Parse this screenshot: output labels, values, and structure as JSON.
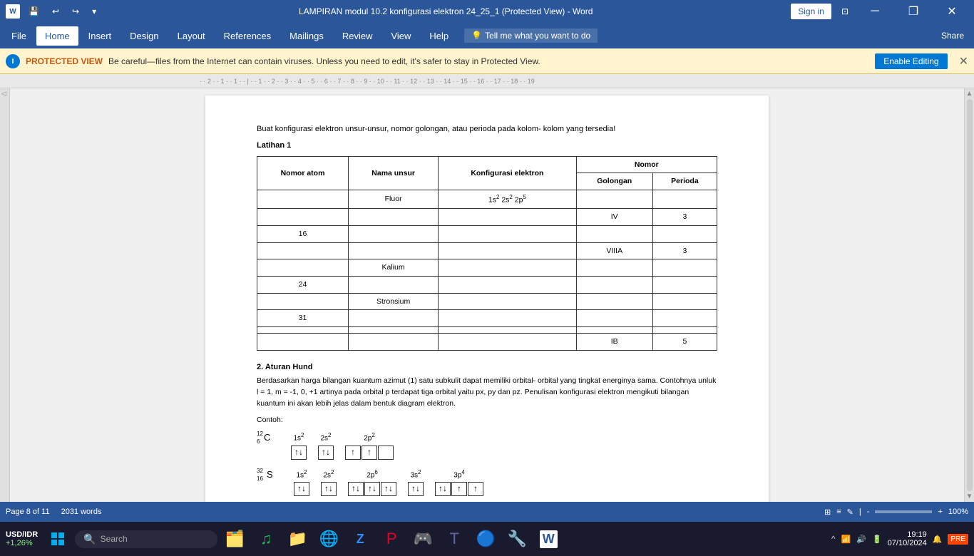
{
  "titlebar": {
    "title": "LAMPIRAN modul 10.2 konfigurasi elektron 24_25_1 (Protected View)  -  Word",
    "sign_in": "Sign in",
    "minimize": "─",
    "restore": "❐",
    "close": "✕"
  },
  "ribbon": {
    "tabs": [
      "File",
      "Home",
      "Insert",
      "Design",
      "Layout",
      "References",
      "Mailings",
      "Review",
      "View",
      "Help"
    ],
    "active_tab": "Home",
    "tell_me": "Tell me what you want to do",
    "share": "Share"
  },
  "protected_bar": {
    "icon": "i",
    "label": "PROTECTED VIEW",
    "message": "Be careful—files from the Internet can contain viruses. Unless you need to edit, it's safer to stay in Protected View.",
    "enable_button": "Enable Editing",
    "close": "✕"
  },
  "document": {
    "intro": "Buat konfigurasi elektron unsur-unsur, nomor golongan, atau perioda pada kolom- kolom yang tersedia!",
    "latihan_title": "Latihan 1",
    "table": {
      "headers": [
        "Nomor atom",
        "Nama unsur",
        "Konfigurasi elektron",
        "Nomor"
      ],
      "nomor_headers": [
        "Golongan",
        "Perioda"
      ],
      "rows": [
        {
          "nomor_atom": "",
          "nama_unsur": "Fluor",
          "konfigurasi": "1s² 2s² 2p⁵",
          "golongan": "",
          "perioda": ""
        },
        {
          "nomor_atom": "",
          "nama_unsur": "",
          "konfigurasi": "",
          "golongan": "IV",
          "perioda": "3"
        },
        {
          "nomor_atom": "16",
          "nama_unsur": "",
          "konfigurasi": "",
          "golongan": "",
          "perioda": ""
        },
        {
          "nomor_atom": "",
          "nama_unsur": "",
          "konfigurasi": "",
          "golongan": "VIIIA",
          "perioda": "3"
        },
        {
          "nomor_atom": "",
          "nama_unsur": "Kalium",
          "konfigurasi": "",
          "golongan": "",
          "perioda": ""
        },
        {
          "nomor_atom": "24",
          "nama_unsur": "",
          "konfigurasi": "",
          "golongan": "",
          "perioda": ""
        },
        {
          "nomor_atom": "",
          "nama_unsur": "Stronsium",
          "konfigurasi": "",
          "golongan": "",
          "perioda": ""
        },
        {
          "nomor_atom": "31",
          "nama_unsur": "",
          "konfigurasi": "",
          "golongan": "",
          "perioda": ""
        },
        {
          "nomor_atom": "",
          "nama_unsur": "",
          "konfigurasi": "",
          "golongan": "",
          "perioda": ""
        },
        {
          "nomor_atom": "",
          "nama_unsur": "",
          "konfigurasi": "",
          "golongan": "IB",
          "perioda": "5"
        }
      ]
    },
    "section2_title": "2. Aturan Hund",
    "section2_body": "Berdasarkan harga bilangan kuantum azimut (1) satu subkulit dapat memiliki orbital- orbital yang tingkat energinya sama. Contohnya unluk l = 1, m = -1, 0, +1 artinya pada orbital p terdapat tiga orbital yaitu px, py dan pz. Penulisan konfigurasi elektron mengikuti bilangan kuantum ini akan lebih jelas dalam bentuk diagram elektron.",
    "contoh_label": "Contoh:",
    "c_atom": "¹²₆C",
    "s_atom": "³²₁₆S",
    "diagrams": {
      "carbon": {
        "groups": [
          {
            "label": "1s²",
            "boxes": [
              "↑↓"
            ]
          },
          {
            "label": "2s²",
            "boxes": [
              "↑↓"
            ]
          },
          {
            "label": "2p²",
            "boxes": [
              "↑",
              "↑",
              ""
            ]
          }
        ]
      },
      "sulfur": {
        "groups": [
          {
            "label": "1s²",
            "boxes": [
              "↑↓"
            ]
          },
          {
            "label": "2s²",
            "boxes": [
              "↑↓"
            ]
          },
          {
            "label": "2p⁶",
            "boxes": [
              "↑↓",
              "↑↓",
              "↑↓"
            ]
          },
          {
            "label": "3s²",
            "boxes": [
              "↑↓"
            ]
          },
          {
            "label": "3p⁴",
            "boxes": [
              "↑↓",
              "↑",
              "↑"
            ]
          }
        ]
      }
    }
  },
  "statusbar": {
    "page_info": "Page 8 of 11",
    "word_count": "2031 words",
    "view_icons": [
      "⊞",
      "≡",
      "✎"
    ],
    "zoom": "100%"
  },
  "taskbar": {
    "start_label": "⊞",
    "search_placeholder": "Search",
    "currency": {
      "name": "USD/IDR",
      "change": "+1,26%"
    },
    "time": "19:19",
    "date": "07/10/2024"
  }
}
